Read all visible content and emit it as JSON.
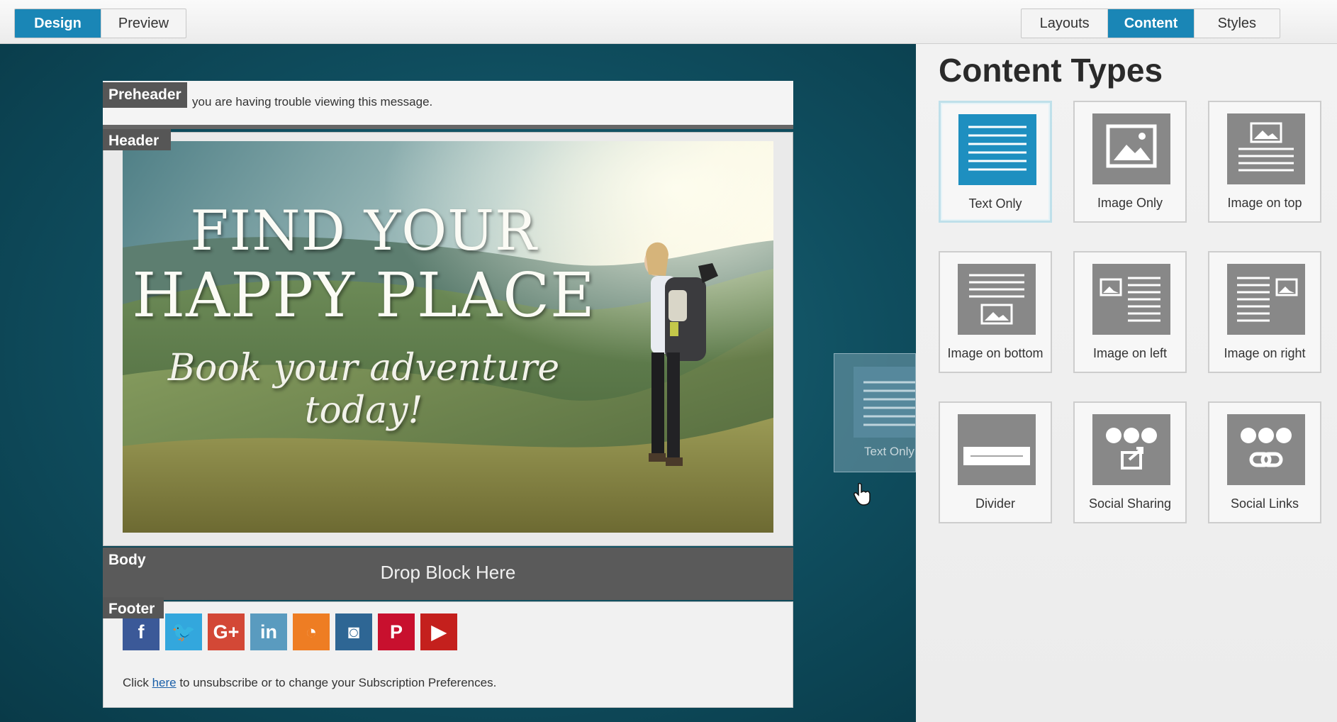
{
  "topbar": {
    "left_tabs": [
      {
        "label": "Design",
        "active": true
      },
      {
        "label": "Preview",
        "active": false
      }
    ],
    "right_tabs": [
      {
        "label": "Layouts",
        "active": false
      },
      {
        "label": "Content",
        "active": true
      },
      {
        "label": "Styles",
        "active": false
      }
    ]
  },
  "email": {
    "preheader": {
      "label": "Preheader",
      "text": "you are having trouble viewing this message."
    },
    "header": {
      "label": "Header",
      "hero_line1": "FIND YOUR",
      "hero_line2": "HAPPY PLACE",
      "hero_line3": "Book your adventure today!"
    },
    "body": {
      "label": "Body",
      "drop_text": "Drop Block Here"
    },
    "footer": {
      "label": "Footer",
      "social_icons": [
        {
          "name": "facebook",
          "glyph": "f",
          "color": "#3b5998"
        },
        {
          "name": "twitter",
          "glyph": "🐦",
          "color": "#33a7dd"
        },
        {
          "name": "google-plus",
          "glyph": "G+",
          "color": "#d34836"
        },
        {
          "name": "linkedin",
          "glyph": "in",
          "color": "#5a9bbf"
        },
        {
          "name": "rss",
          "glyph": "◔",
          "color": "#ee7d23"
        },
        {
          "name": "instagram",
          "glyph": "◙",
          "color": "#2e6694"
        },
        {
          "name": "pinterest",
          "glyph": "P",
          "color": "#c8102e"
        },
        {
          "name": "youtube",
          "glyph": "▶",
          "color": "#c4201d"
        }
      ],
      "text_before": "Click ",
      "link_text": "here",
      "text_after": " to unsubscribe or to change your Subscription Preferences."
    }
  },
  "drag_ghost": {
    "label": "Text Only"
  },
  "panel": {
    "title": "Content Types",
    "tiles": [
      {
        "label": "Text Only",
        "icon": "text-only-icon",
        "selected": true
      },
      {
        "label": "Image Only",
        "icon": "image-only-icon",
        "selected": false
      },
      {
        "label": "Image on top",
        "icon": "image-on-top-icon",
        "selected": false
      },
      {
        "label": "Image on bottom",
        "icon": "image-on-bottom-icon",
        "selected": false
      },
      {
        "label": "Image on left",
        "icon": "image-on-left-icon",
        "selected": false
      },
      {
        "label": "Image on right",
        "icon": "image-on-right-icon",
        "selected": false
      },
      {
        "label": "Divider",
        "icon": "divider-icon",
        "selected": false
      },
      {
        "label": "Social Sharing",
        "icon": "social-sharing-icon",
        "selected": false
      },
      {
        "label": "Social Links",
        "icon": "social-links-icon",
        "selected": false
      }
    ]
  },
  "colors": {
    "accent": "#1a86b6",
    "canvas_bg": "#0f4d5e",
    "thumb_gray": "#888888"
  }
}
